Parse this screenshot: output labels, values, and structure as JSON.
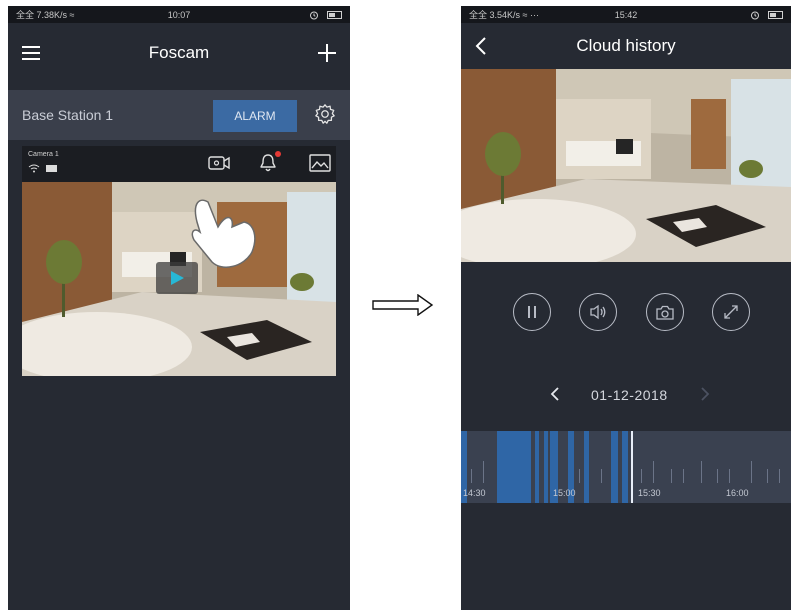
{
  "left_screen": {
    "status": {
      "signal": "全全 7.38K/s ≈",
      "time": "10:07"
    },
    "app_title": "Foscam",
    "station": {
      "name": "Base Station 1",
      "alarm_label": "ALARM"
    },
    "camera": {
      "name": "Camera 1"
    }
  },
  "right_screen": {
    "status": {
      "signal": "全全 3.54K/s ≈ ···",
      "time": "15:42"
    },
    "title": "Cloud history",
    "date": "01-12-2018",
    "timeline_labels": [
      "14:30",
      "15:00",
      "15:30",
      "16:00"
    ]
  },
  "colors": {
    "background": "#262a33",
    "accent": "#3b6aa3",
    "recording": "#2f66a6",
    "alert": "#e53935"
  }
}
